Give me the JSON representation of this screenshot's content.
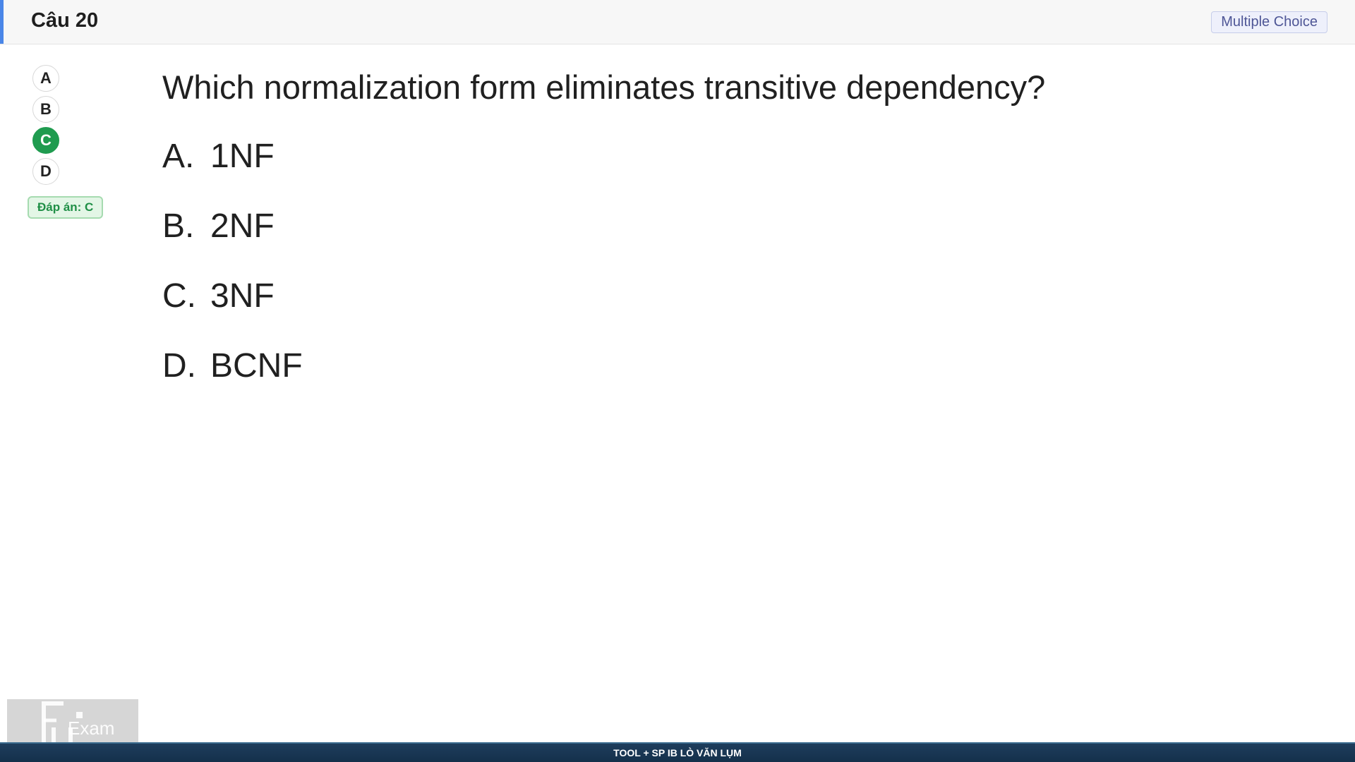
{
  "header": {
    "title": "Câu 20",
    "question_type": "Multiple Choice"
  },
  "option_nav": {
    "items": [
      "A",
      "B",
      "C",
      "D"
    ],
    "selected": "C"
  },
  "answer_badge": "Đáp án: C",
  "question": {
    "text": "Which normalization form eliminates transitive dependency?",
    "choices": [
      {
        "letter": "A.",
        "text": "1NF"
      },
      {
        "letter": "B.",
        "text": "2NF"
      },
      {
        "letter": "C.",
        "text": "3NF"
      },
      {
        "letter": "D.",
        "text": "BCNF"
      }
    ]
  },
  "logo": {
    "text": "Exam",
    "icon": "fu-exam-logo"
  },
  "footer": {
    "text": "TOOL + SP IB LÒ VĂN LỤM"
  },
  "colors": {
    "accent": "#4a86e8",
    "selected": "#1f9b4f",
    "answer_bg": "#e3f6e6",
    "footer_bg": "#1e3d5c"
  }
}
